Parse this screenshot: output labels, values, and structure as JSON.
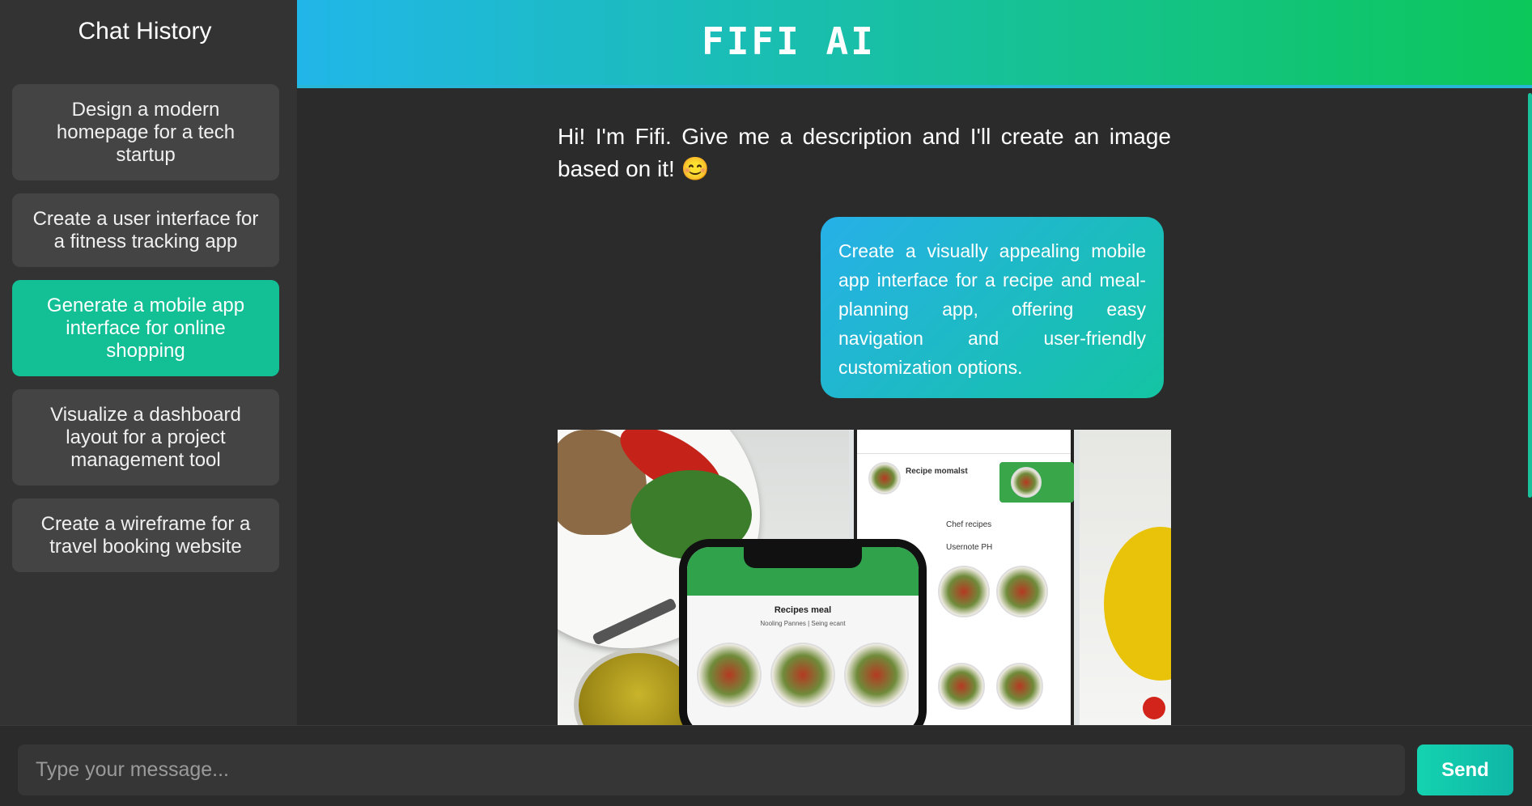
{
  "sidebar": {
    "title": "Chat History",
    "items": [
      {
        "label": "Design a modern homepage for a tech startup",
        "active": false
      },
      {
        "label": "Create a user interface for a fitness tracking app",
        "active": false
      },
      {
        "label": "Generate a mobile app interface for online shopping",
        "active": true
      },
      {
        "label": "Visualize a dashboard layout for a project management tool",
        "active": false
      },
      {
        "label": "Create a wireframe for a travel booking website",
        "active": false
      }
    ]
  },
  "header": {
    "brand": "FIFI AI"
  },
  "chat": {
    "bot_greeting": "Hi! I'm Fifi. Give me a description and I'll create an image based on it! 😊",
    "user_message": "Create a visually appealing mobile app interface for a recipe and meal-planning app, offering easy navigation and user-friendly customization options.",
    "generated_image": {
      "back_phone_title": "Recipe momalst",
      "back_phone_section": "Chef recipes",
      "back_phone_section2": "Usernote PH",
      "front_phone_title": "Recipes meal",
      "front_phone_subtitle": "Nooling Pannes | Seing ecant"
    }
  },
  "composer": {
    "placeholder": "Type your message...",
    "send_label": "Send"
  },
  "colors": {
    "accent": "#13bf95",
    "header_start": "#21b6e8",
    "header_end": "#0cc75a",
    "background": "#2b2b2b",
    "sidebar": "#333333"
  }
}
